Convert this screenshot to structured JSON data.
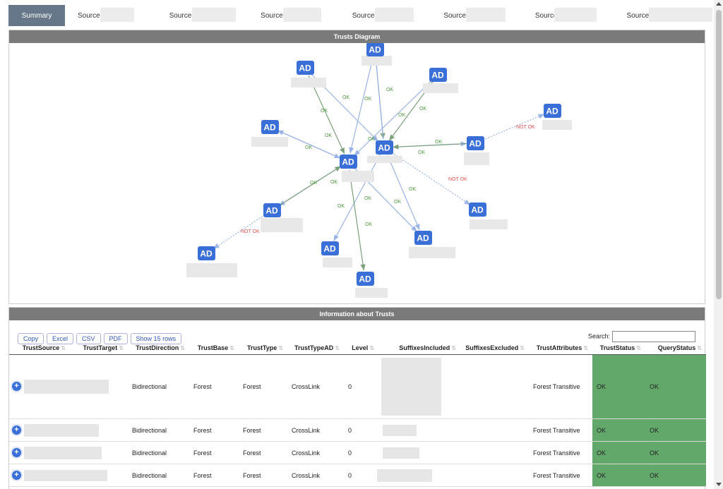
{
  "tabs": [
    "Summary",
    "Source",
    "Source",
    "Source",
    "Source",
    "Source",
    "Source",
    "Source"
  ],
  "diagram": {
    "header": "Trusts Diagram",
    "node_label": "AD",
    "ok_label": "OK",
    "notok_label": "NOT OK"
  },
  "info": {
    "header": "Information about Trusts",
    "buttons": [
      "Copy",
      "Excel",
      "CSV",
      "PDF",
      "Show 15 rows"
    ],
    "search_label": "Search:",
    "search_value": "",
    "columns": [
      "TrustSource",
      "TrustTarget",
      "TrustDirection",
      "TrustBase",
      "TrustType",
      "TrustTypeAD",
      "Level",
      "SuffixesIncluded",
      "SuffixesExcluded",
      "TrustAttributes",
      "TrustStatus",
      "QueryStatus"
    ],
    "rows": [
      {
        "direction": "Bidirectional",
        "base": "Forest",
        "type": "Forest",
        "type_ad": "CrossLink",
        "level": "0",
        "attributes": "Forest Transitive",
        "status": "OK",
        "query": "OK"
      },
      {
        "direction": "Bidirectional",
        "base": "Forest",
        "type": "Forest",
        "type_ad": "CrossLink",
        "level": "0",
        "attributes": "Forest Transitive",
        "status": "OK",
        "query": "OK"
      },
      {
        "direction": "Bidirectional",
        "base": "Forest",
        "type": "Forest",
        "type_ad": "CrossLink",
        "level": "0",
        "attributes": "Forest Transitive",
        "status": "OK",
        "query": "OK"
      },
      {
        "direction": "Bidirectional",
        "base": "Forest",
        "type": "Forest",
        "type_ad": "CrossLink",
        "level": "0",
        "attributes": "Forest Transitive",
        "status": "OK",
        "query": "OK"
      }
    ]
  },
  "colors": {
    "ad_node": "#3a6fd8",
    "ok": "#4a9a3a",
    "not_ok": "#e05050",
    "active_tab": "#66778a",
    "status_green": "#62a86b"
  }
}
